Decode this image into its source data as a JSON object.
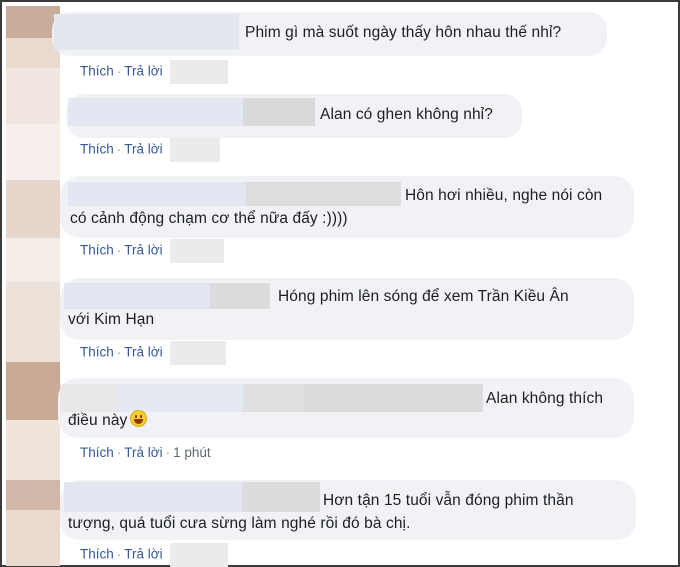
{
  "colors": {
    "bubble": "#f0f2f5",
    "link": "#385898",
    "text": "#1c1e21",
    "avatar_light": "#eadcd3",
    "avatar_dark": "#c9ad9c"
  },
  "actions": {
    "like_label": "Thích",
    "reply_label": "Trả lời",
    "separator": "·"
  },
  "comments": [
    {
      "lines": [
        "Phim gì mà suốt ngày thấy hôn nhau thế nhỉ?"
      ],
      "time": ""
    },
    {
      "lines": [
        "Alan có ghen không nhỉ?"
      ],
      "time": ""
    },
    {
      "lines": [
        "Hôn hơi nhiều, nghe nói còn",
        "có cảnh động chạm cơ thể nữa đấy :))))"
      ],
      "time": ""
    },
    {
      "lines": [
        "Hóng phim lên sóng để xem Trần Kiều Ân",
        "với Kim Hạn"
      ],
      "time": ""
    },
    {
      "lines": [
        "Alan không thích",
        "điều này"
      ],
      "emoji": "smile-emoji",
      "time": "1 phút"
    },
    {
      "lines": [
        "Hơn tận 15 tuổi vẫn đóng phim thần",
        "tượng, quá tuổi cưa sừng làm nghé rồi đó bà chị."
      ],
      "time": ""
    }
  ]
}
